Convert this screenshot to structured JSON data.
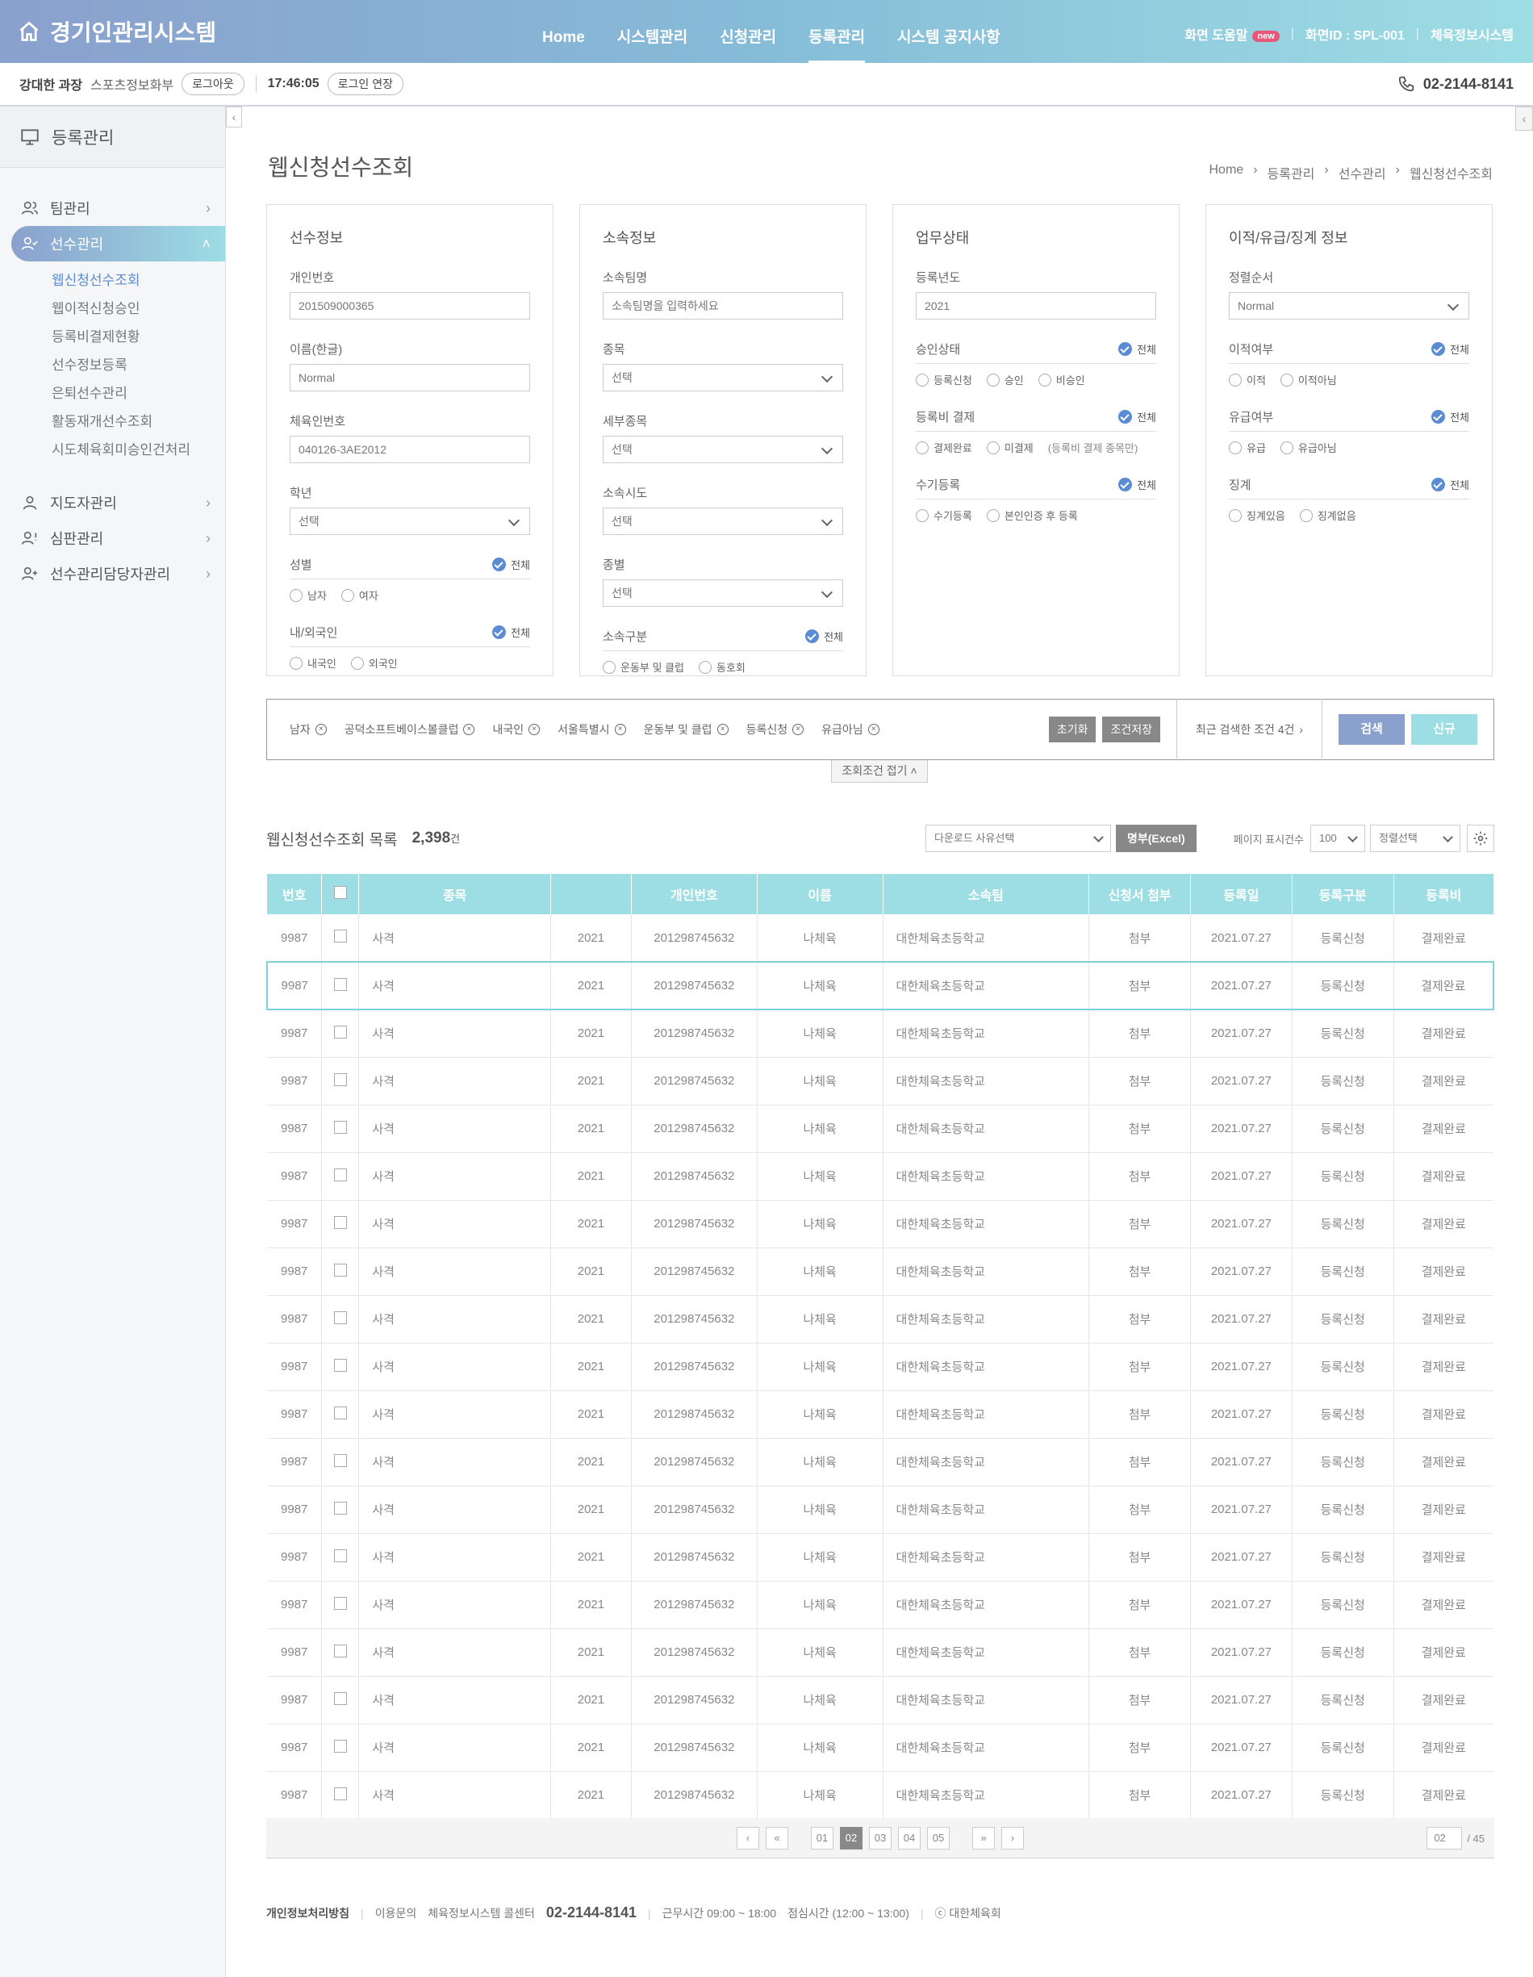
{
  "header": {
    "title": "경기인관리시스템",
    "nav": [
      "Home",
      "시스템관리",
      "신청관리",
      "등록관리",
      "시스템 공지사항"
    ],
    "active_nav_index": 3,
    "help": "화면 도움말",
    "new_badge": "new",
    "screen_id": "화면ID : SPL-001",
    "sys_link": "체육정보시스템"
  },
  "userbar": {
    "name": "강대한 과장",
    "dept": "스포츠정보화부",
    "logout": "로그아웃",
    "time": "17:46:05",
    "extend": "로그인 연장",
    "phone": "02-2144-8141"
  },
  "sidebar": {
    "title": "등록관리",
    "menus": [
      {
        "label": "팀관리"
      },
      {
        "label": "선수관리"
      },
      {
        "label": "지도자관리"
      },
      {
        "label": "심판관리"
      },
      {
        "label": "선수관리담당자관리"
      }
    ],
    "sub": [
      "웹신청선수조회",
      "웹이적신청승인",
      "등록비결제현황",
      "선수정보등록",
      "은퇴선수관리",
      "활동재개선수조회",
      "시도체육회미승인건처리"
    ]
  },
  "page": {
    "title": "웹신청선수조회",
    "breadcrumb": [
      "Home",
      "등록관리",
      "선수관리",
      "웹신청선수조회"
    ]
  },
  "panels": {
    "p1": {
      "title": "선수정보",
      "f1_label": "개인번호",
      "f1_value": "201509000365",
      "f2_label": "이름(한글)",
      "f2_value": "Normal",
      "f3_label": "체육인번호",
      "f3_value": "040126-3AE2012",
      "f4_label": "학년",
      "f4_value": "선택",
      "g1_label": "성별",
      "g1_all": "전체",
      "g1_opts": [
        "남자",
        "여자"
      ],
      "g2_label": "내/외국인",
      "g2_all": "전체",
      "g2_opts": [
        "내국인",
        "외국인"
      ]
    },
    "p2": {
      "title": "소속정보",
      "f1_label": "소속팀명",
      "f1_ph": "소속팀명을 입력하세요",
      "f2_label": "종목",
      "f2_value": "선택",
      "f3_label": "세부종목",
      "f3_value": "선택",
      "f4_label": "소속시도",
      "f4_value": "선택",
      "f5_label": "종별",
      "f5_value": "선택",
      "g1_label": "소속구분",
      "g1_all": "전체",
      "g1_opts": [
        "운동부 및 클럽",
        "동호회"
      ]
    },
    "p3": {
      "title": "업무상태",
      "f1_label": "등록년도",
      "f1_value": "2021",
      "g1_label": "승인상태",
      "g1_all": "전체",
      "g1_opts": [
        "등록신청",
        "승인",
        "비승인"
      ],
      "g2_label": "등록비 결제",
      "g2_all": "전체",
      "g2_opts": [
        "결제완료",
        "미결제"
      ],
      "g2_note": "(등록비 결제 종목만)",
      "g3_label": "수기등록",
      "g3_all": "전체",
      "g3_opts": [
        "수기등록",
        "본인인증 후 등록"
      ]
    },
    "p4": {
      "title": "이적/유급/징계 정보",
      "f1_label": "정렬순서",
      "f1_value": "Normal",
      "g1_label": "이적여부",
      "g1_all": "전체",
      "g1_opts": [
        "이적",
        "이적아님"
      ],
      "g2_label": "유급여부",
      "g2_all": "전체",
      "g2_opts": [
        "유급",
        "유급아님"
      ],
      "g3_label": "징계",
      "g3_all": "전체",
      "g3_opts": [
        "징계있음",
        "징계없음"
      ]
    }
  },
  "conditions": {
    "tags": [
      "남자",
      "공덕소프트베이스볼클럽",
      "내국인",
      "서울특별시",
      "운동부 및 클럽",
      "등록신청",
      "유급아님"
    ],
    "reset": "초기화",
    "save": "조건저장",
    "recent": "최근 검색한 조건 4건",
    "search": "검색",
    "new": "신규",
    "fold": "조회조건 접기"
  },
  "list": {
    "title": "웹신청선수조회 목록",
    "count": "2,398",
    "unit": "건",
    "download_ph": "다운로드 사유선택",
    "excel": "명부(Excel)",
    "page_size_label": "페이지 표시건수",
    "page_size": "100",
    "sort": "정렬선택",
    "columns": [
      "번호",
      "",
      "종목",
      "",
      "개인번호",
      "이름",
      "소속팀",
      "신청서 첨부",
      "등록일",
      "등록구분",
      "등록비"
    ],
    "rows": [
      [
        "9987",
        "",
        "사격",
        "2021",
        "201298745632",
        "나체육",
        "대한체육초등학교",
        "첨부",
        "2021.07.27",
        "등록신청",
        "결제완료"
      ],
      [
        "9987",
        "",
        "사격",
        "2021",
        "201298745632",
        "나체육",
        "대한체육초등학교",
        "첨부",
        "2021.07.27",
        "등록신청",
        "결제완료"
      ],
      [
        "9987",
        "",
        "사격",
        "2021",
        "201298745632",
        "나체육",
        "대한체육초등학교",
        "첨부",
        "2021.07.27",
        "등록신청",
        "결제완료"
      ],
      [
        "9987",
        "",
        "사격",
        "2021",
        "201298745632",
        "나체육",
        "대한체육초등학교",
        "첨부",
        "2021.07.27",
        "등록신청",
        "결제완료"
      ],
      [
        "9987",
        "",
        "사격",
        "2021",
        "201298745632",
        "나체육",
        "대한체육초등학교",
        "첨부",
        "2021.07.27",
        "등록신청",
        "결제완료"
      ],
      [
        "9987",
        "",
        "사격",
        "2021",
        "201298745632",
        "나체육",
        "대한체육초등학교",
        "첨부",
        "2021.07.27",
        "등록신청",
        "결제완료"
      ],
      [
        "9987",
        "",
        "사격",
        "2021",
        "201298745632",
        "나체육",
        "대한체육초등학교",
        "첨부",
        "2021.07.27",
        "등록신청",
        "결제완료"
      ],
      [
        "9987",
        "",
        "사격",
        "2021",
        "201298745632",
        "나체육",
        "대한체육초등학교",
        "첨부",
        "2021.07.27",
        "등록신청",
        "결제완료"
      ],
      [
        "9987",
        "",
        "사격",
        "2021",
        "201298745632",
        "나체육",
        "대한체육초등학교",
        "첨부",
        "2021.07.27",
        "등록신청",
        "결제완료"
      ],
      [
        "9987",
        "",
        "사격",
        "2021",
        "201298745632",
        "나체육",
        "대한체육초등학교",
        "첨부",
        "2021.07.27",
        "등록신청",
        "결제완료"
      ],
      [
        "9987",
        "",
        "사격",
        "2021",
        "201298745632",
        "나체육",
        "대한체육초등학교",
        "첨부",
        "2021.07.27",
        "등록신청",
        "결제완료"
      ],
      [
        "9987",
        "",
        "사격",
        "2021",
        "201298745632",
        "나체육",
        "대한체육초등학교",
        "첨부",
        "2021.07.27",
        "등록신청",
        "결제완료"
      ],
      [
        "9987",
        "",
        "사격",
        "2021",
        "201298745632",
        "나체육",
        "대한체육초등학교",
        "첨부",
        "2021.07.27",
        "등록신청",
        "결제완료"
      ],
      [
        "9987",
        "",
        "사격",
        "2021",
        "201298745632",
        "나체육",
        "대한체육초등학교",
        "첨부",
        "2021.07.27",
        "등록신청",
        "결제완료"
      ],
      [
        "9987",
        "",
        "사격",
        "2021",
        "201298745632",
        "나체육",
        "대한체육초등학교",
        "첨부",
        "2021.07.27",
        "등록신청",
        "결제완료"
      ],
      [
        "9987",
        "",
        "사격",
        "2021",
        "201298745632",
        "나체육",
        "대한체육초등학교",
        "첨부",
        "2021.07.27",
        "등록신청",
        "결제완료"
      ],
      [
        "9987",
        "",
        "사격",
        "2021",
        "201298745632",
        "나체육",
        "대한체육초등학교",
        "첨부",
        "2021.07.27",
        "등록신청",
        "결제완료"
      ],
      [
        "9987",
        "",
        "사격",
        "2021",
        "201298745632",
        "나체육",
        "대한체육초등학교",
        "첨부",
        "2021.07.27",
        "등록신청",
        "결제완료"
      ],
      [
        "9987",
        "",
        "사격",
        "2021",
        "201298745632",
        "나체육",
        "대한체육초등학교",
        "첨부",
        "2021.07.27",
        "등록신청",
        "결제완료"
      ]
    ],
    "highlight_row": 1
  },
  "pagination": {
    "pages": [
      "01",
      "02",
      "03",
      "04",
      "05"
    ],
    "current": "02",
    "goto": "02",
    "total": "/ 45"
  },
  "footer": {
    "privacy": "개인정보처리방침",
    "contact_label": "이용문의",
    "contact_center": "체육정보시스템 콜센터",
    "contact_phone": "02-2144-8141",
    "hours": "근무시간 09:00 ~ 18:00",
    "lunch": "점심시간 (12:00 ~ 13:00)",
    "copyright": "ⓒ 대한체육회"
  },
  "colors": {
    "accent": "#5b8bd3",
    "header_start": "#8aa0cd",
    "header_end": "#9ddde4",
    "table_head": "#9ddde4",
    "search_btn": "#8aa0cd",
    "new_btn": "#9ddde4"
  }
}
